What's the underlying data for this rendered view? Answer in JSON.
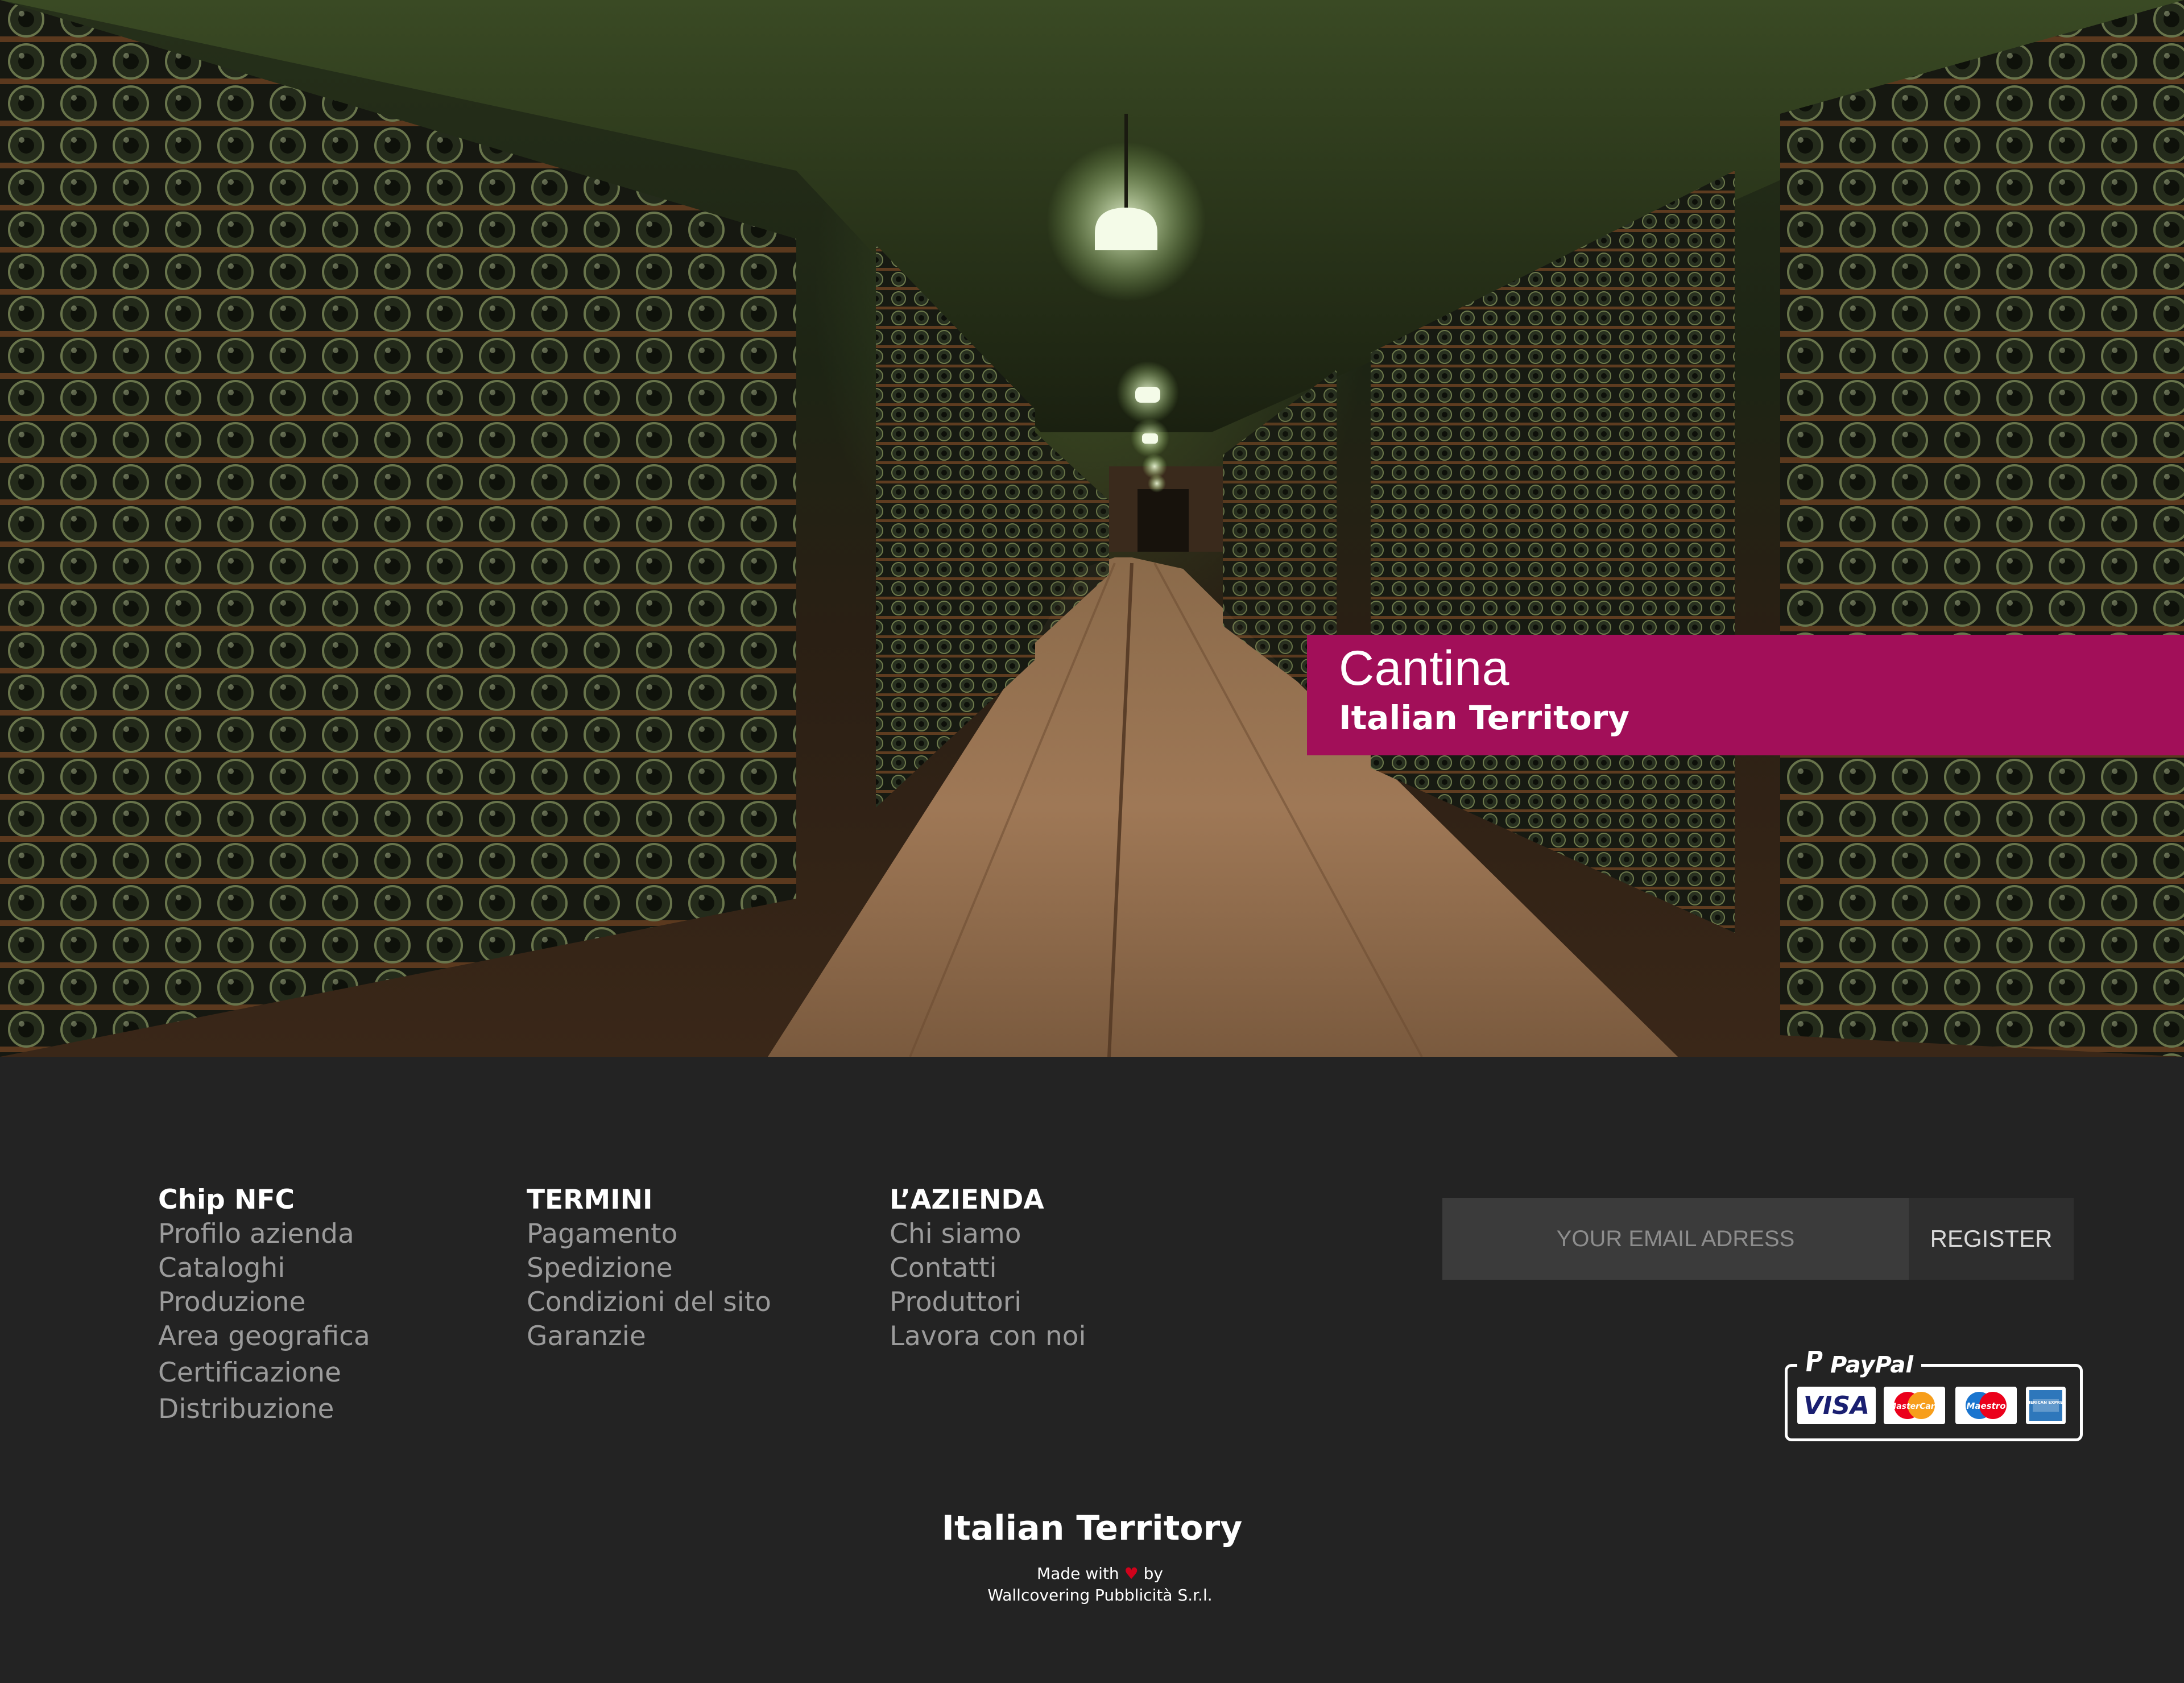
{
  "hero": {
    "banner_title": "Cantina",
    "banner_subtitle": "Italian Territory",
    "accent_color": "#a20f59"
  },
  "footer": {
    "columns": [
      {
        "heading": "Chip NFC",
        "links": [
          "Profilo azienda",
          "Cataloghi",
          "Produzione",
          "Area geografica",
          "Certificazione",
          "Distribuzione"
        ]
      },
      {
        "heading": "TERMINI",
        "links": [
          "Pagamento",
          "Spedizione",
          "Condizioni del sito",
          "Garanzie"
        ]
      },
      {
        "heading": "L’AZIENDA",
        "links": [
          "Chi siamo",
          "Contatti",
          "Produttori",
          "Lavora con noi"
        ]
      }
    ],
    "newsletter": {
      "placeholder": "YOUR EMAIL ADRESS",
      "button_label": "REGISTER"
    },
    "payments": {
      "provider": "PayPal",
      "cards": [
        "VISA",
        "MasterCard",
        "Maestro",
        "AMERICAN EXPRESS"
      ]
    },
    "brand": "Italian Territory",
    "made_with_prefix": "Made with",
    "made_with_suffix": "by",
    "credit": "Wallcovering Pubblicità S.r.l.",
    "heart_icon": "heart-icon"
  }
}
